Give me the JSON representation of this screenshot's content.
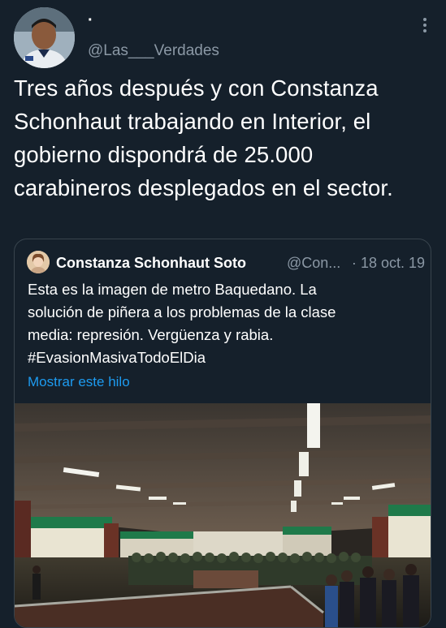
{
  "tweet": {
    "display_name": "·",
    "handle": "@Las___Verdades",
    "text": "Tres años después y con Constanza Schonhaut trabajando en Interior, el gobierno dispondrá de 25.000 carabineros desplegados en el sector."
  },
  "quote": {
    "author_name": "Constanza Schonhaut Soto",
    "handle": "@Con...",
    "separator": "·",
    "date": "18 oct. 19",
    "text_lines": [
      "Esta es la  imagen de metro Baquedano. La",
      "solución de piñera a los problemas de la clase",
      "media: represión. Vergüenza y rabia.",
      "#EvasionMasivaTodoElDia"
    ],
    "show_thread_label": "Mostrar este hilo",
    "image_icon": "metro-station-photo"
  },
  "colors": {
    "background": "#15202b",
    "secondary_text": "#8b98a5",
    "link": "#1d9bf0",
    "border": "#38444d"
  },
  "icons": {
    "more": "more-vertical-icon"
  }
}
